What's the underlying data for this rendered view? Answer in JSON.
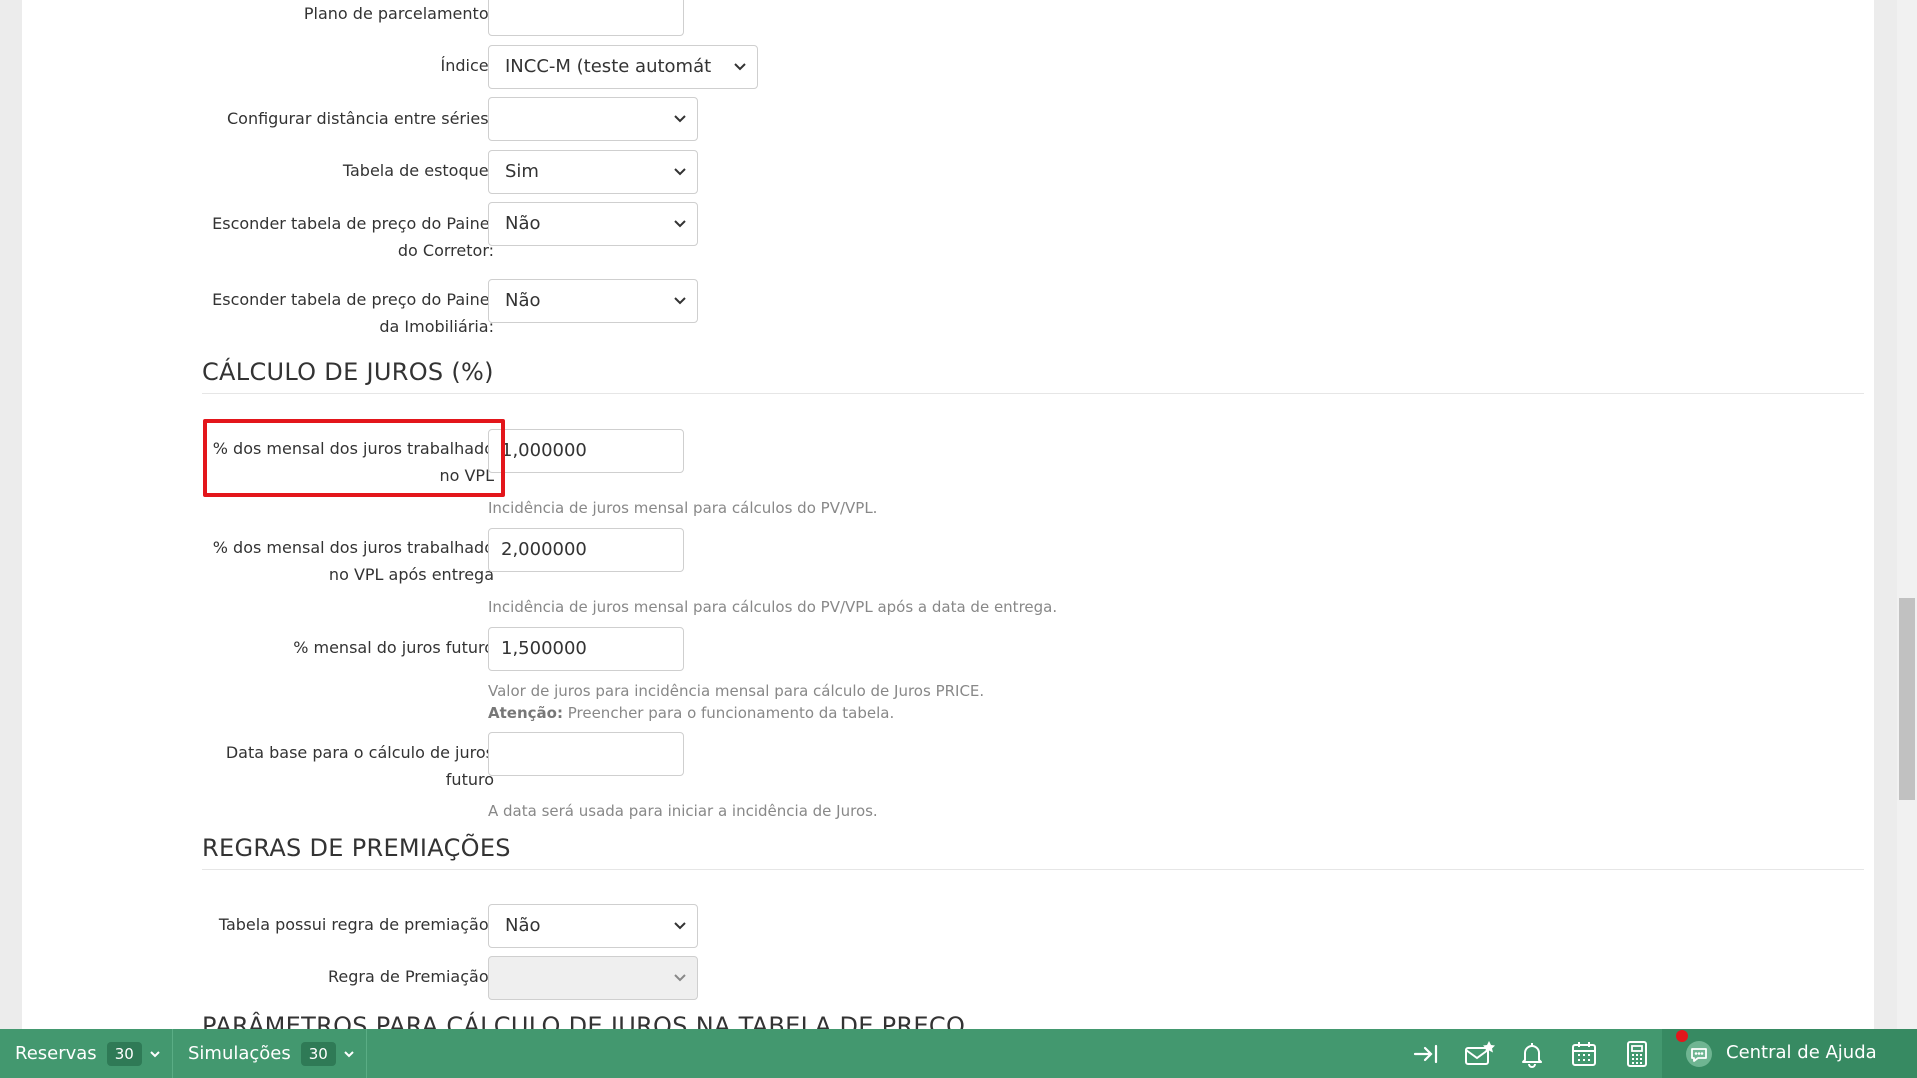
{
  "form": {
    "plano_parcelamento": {
      "label": "Plano de parcelamento:",
      "value": ""
    },
    "indice": {
      "label": "Índice:",
      "value": "INCC-M (teste automát"
    },
    "distancia_series": {
      "label": "Configurar distância entre séries:",
      "value": ""
    },
    "tabela_estoque": {
      "label": "Tabela de estoque:",
      "value": "Sim"
    },
    "esconder_corretor": {
      "label_line1": "Esconder tabela de preço do Painel",
      "label_line2": "do Corretor:",
      "value": "Não"
    },
    "esconder_imobiliaria": {
      "label_line1": "Esconder tabela de preço do Painel",
      "label_line2": "da Imobiliária:",
      "value": "Não"
    }
  },
  "juros": {
    "title": "CÁLCULO DE JUROS (%)",
    "vpl": {
      "label_line1": "% dos mensal dos juros trabalhado",
      "label_line2": "no VPL",
      "value": "1,000000",
      "help": "Incidência de juros mensal para cálculos do PV/VPL."
    },
    "vpl_entrega": {
      "label_line1": "% dos mensal dos juros trabalhado",
      "label_line2": "no VPL após entrega",
      "value": "2,000000",
      "help": "Incidência de juros mensal para cálculos do PV/VPL após a data de entrega."
    },
    "futuro": {
      "label": "% mensal do juros futuro",
      "value": "1,500000",
      "help_line1": "Valor de juros para incidência mensal para cálculo de Juros PRICE.",
      "help_bold": "Atenção:",
      "help_line2": "Preencher para o funcionamento da tabela."
    },
    "data_base": {
      "label_line1": "Data base para o cálculo de juros",
      "label_line2": "futuro",
      "value": "",
      "help": "A data será usada para iniciar a incidência de Juros."
    }
  },
  "premiacoes": {
    "title": "REGRAS DE PREMIAÇÕES",
    "possui": {
      "label": "Tabela possui regra de premiação:",
      "value": "Não"
    },
    "regra": {
      "label": "Regra de Premiação:",
      "value": ""
    }
  },
  "next_section_title": "PARÂMETROS PARA CÁLCULO DE JUROS NA TABELA DE PREÇO",
  "bottombar": {
    "reservas_label": "Reservas",
    "reservas_count": "30",
    "simulacoes_label": "Simulações",
    "simulacoes_count": "30",
    "help_label": "Central de Ajuda",
    "icons": [
      "collapse-right-icon",
      "mail-star-icon",
      "bell-icon",
      "calendar-icon",
      "calculator-icon",
      "chat-help-icon"
    ],
    "bg_color": "#43986f",
    "highlight_color": "#e3161b"
  }
}
